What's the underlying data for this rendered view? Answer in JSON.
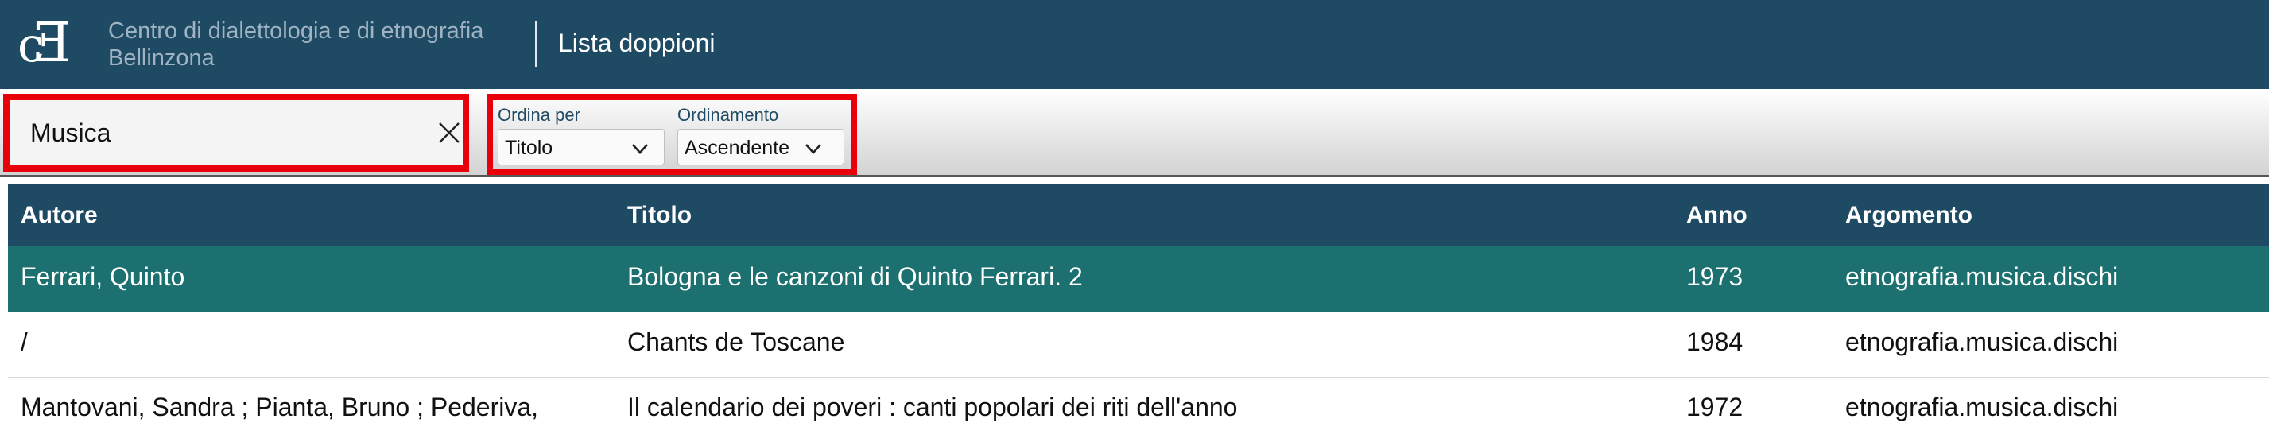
{
  "header": {
    "institution_line1": "Centro di dialettologia e di etnografia",
    "institution_line2": "Bellinzona",
    "page_title": "Lista doppioni"
  },
  "toolbar": {
    "search": {
      "value": "Musica",
      "clear_icon": "close-icon"
    },
    "sort_by": {
      "label": "Ordina per",
      "selected": "Titolo"
    },
    "sort_order": {
      "label": "Ordinamento",
      "selected": "Ascendente"
    }
  },
  "table": {
    "columns": [
      "Autore",
      "Titolo",
      "Anno",
      "Argomento"
    ],
    "rows": [
      {
        "autore": "Ferrari, Quinto",
        "titolo": "Bologna e le canzoni di Quinto Ferrari. 2",
        "anno": "1973",
        "argomento": "etnografia.musica.dischi",
        "selected": true
      },
      {
        "autore": "/",
        "titolo": "Chants de Toscane",
        "anno": "1984",
        "argomento": "etnografia.musica.dischi",
        "selected": false
      },
      {
        "autore": "Mantovani, Sandra ; Pianta, Bruno ; Pederiva,",
        "titolo": "Il calendario dei poveri : canti popolari dei riti dell'anno",
        "anno": "1972",
        "argomento": "etnografia.musica.dischi",
        "selected": false
      }
    ]
  },
  "colors": {
    "header_bg": "#1e4a63",
    "selected_row_bg": "#1c7070",
    "highlight_border": "#e8000b"
  }
}
